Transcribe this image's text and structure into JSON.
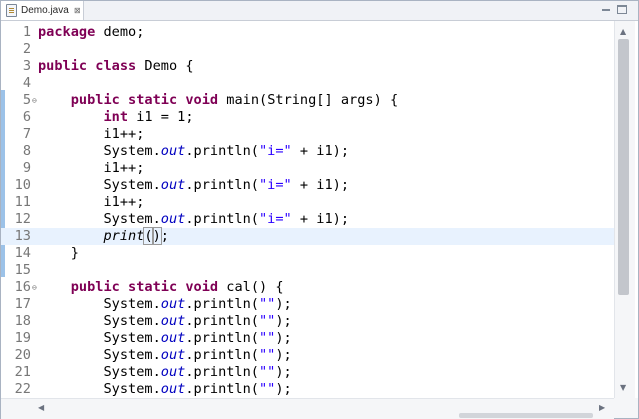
{
  "tab": {
    "label": "Demo.java",
    "close_glyph": "⊠",
    "icon": "java-file-icon"
  },
  "window_controls": {
    "minimize_icon": "minimize-icon",
    "maximize_icon": "maximize-icon"
  },
  "editor": {
    "lines": [
      {
        "num": "1",
        "tokens": [
          {
            "t": "kw",
            "v": "package"
          },
          {
            "t": "txt",
            "v": " demo;"
          }
        ]
      },
      {
        "num": "2",
        "tokens": []
      },
      {
        "num": "3",
        "tokens": [
          {
            "t": "kw",
            "v": "public"
          },
          {
            "t": "txt",
            "v": " "
          },
          {
            "t": "kw",
            "v": "class"
          },
          {
            "t": "txt",
            "v": " Demo {"
          }
        ]
      },
      {
        "num": "4",
        "tokens": []
      },
      {
        "num": "5",
        "fold": "⊖",
        "tokens": [
          {
            "t": "txt",
            "v": "    "
          },
          {
            "t": "kw",
            "v": "public"
          },
          {
            "t": "txt",
            "v": " "
          },
          {
            "t": "kw",
            "v": "static"
          },
          {
            "t": "txt",
            "v": " "
          },
          {
            "t": "kw",
            "v": "void"
          },
          {
            "t": "txt",
            "v": " main(String[] args) {"
          }
        ]
      },
      {
        "num": "6",
        "tokens": [
          {
            "t": "txt",
            "v": "        "
          },
          {
            "t": "kw",
            "v": "int"
          },
          {
            "t": "txt",
            "v": " i1 = 1;"
          }
        ]
      },
      {
        "num": "7",
        "tokens": [
          {
            "t": "txt",
            "v": "        i1++;"
          }
        ]
      },
      {
        "num": "8",
        "tokens": [
          {
            "t": "txt",
            "v": "        System."
          },
          {
            "t": "field",
            "v": "out"
          },
          {
            "t": "txt",
            "v": ".println("
          },
          {
            "t": "str",
            "v": "\"i=\""
          },
          {
            "t": "txt",
            "v": " + i1);"
          }
        ]
      },
      {
        "num": "9",
        "tokens": [
          {
            "t": "txt",
            "v": "        i1++;"
          }
        ]
      },
      {
        "num": "10",
        "tokens": [
          {
            "t": "txt",
            "v": "        System."
          },
          {
            "t": "field",
            "v": "out"
          },
          {
            "t": "txt",
            "v": ".println("
          },
          {
            "t": "str",
            "v": "\"i=\""
          },
          {
            "t": "txt",
            "v": " + i1);"
          }
        ]
      },
      {
        "num": "11",
        "tokens": [
          {
            "t": "txt",
            "v": "        i1++;"
          }
        ]
      },
      {
        "num": "12",
        "tokens": [
          {
            "t": "txt",
            "v": "        System."
          },
          {
            "t": "field",
            "v": "out"
          },
          {
            "t": "txt",
            "v": ".println("
          },
          {
            "t": "str",
            "v": "\"i=\""
          },
          {
            "t": "txt",
            "v": " + i1);"
          }
        ]
      },
      {
        "num": "13",
        "current": true,
        "tokens": [
          {
            "t": "txt",
            "v": "        "
          },
          {
            "t": "it",
            "v": "print"
          },
          {
            "t": "box",
            "v": "("
          },
          {
            "t": "box",
            "v": ")"
          },
          {
            "t": "txt",
            "v": ";"
          }
        ]
      },
      {
        "num": "14",
        "tokens": [
          {
            "t": "txt",
            "v": "    }"
          }
        ]
      },
      {
        "num": "15",
        "tokens": []
      },
      {
        "num": "16",
        "fold": "⊖",
        "tokens": [
          {
            "t": "txt",
            "v": "    "
          },
          {
            "t": "kw",
            "v": "public"
          },
          {
            "t": "txt",
            "v": " "
          },
          {
            "t": "kw",
            "v": "static"
          },
          {
            "t": "txt",
            "v": " "
          },
          {
            "t": "kw",
            "v": "void"
          },
          {
            "t": "txt",
            "v": " cal() {"
          }
        ]
      },
      {
        "num": "17",
        "tokens": [
          {
            "t": "txt",
            "v": "        System."
          },
          {
            "t": "field",
            "v": "out"
          },
          {
            "t": "txt",
            "v": ".println("
          },
          {
            "t": "str",
            "v": "\"\""
          },
          {
            "t": "txt",
            "v": ");"
          }
        ]
      },
      {
        "num": "18",
        "tokens": [
          {
            "t": "txt",
            "v": "        System."
          },
          {
            "t": "field",
            "v": "out"
          },
          {
            "t": "txt",
            "v": ".println("
          },
          {
            "t": "str",
            "v": "\"\""
          },
          {
            "t": "txt",
            "v": ");"
          }
        ]
      },
      {
        "num": "19",
        "tokens": [
          {
            "t": "txt",
            "v": "        System."
          },
          {
            "t": "field",
            "v": "out"
          },
          {
            "t": "txt",
            "v": ".println("
          },
          {
            "t": "str",
            "v": "\"\""
          },
          {
            "t": "txt",
            "v": ");"
          }
        ]
      },
      {
        "num": "20",
        "tokens": [
          {
            "t": "txt",
            "v": "        System."
          },
          {
            "t": "field",
            "v": "out"
          },
          {
            "t": "txt",
            "v": ".println("
          },
          {
            "t": "str",
            "v": "\"\""
          },
          {
            "t": "txt",
            "v": ");"
          }
        ]
      },
      {
        "num": "21",
        "tokens": [
          {
            "t": "txt",
            "v": "        System."
          },
          {
            "t": "field",
            "v": "out"
          },
          {
            "t": "txt",
            "v": ".println("
          },
          {
            "t": "str",
            "v": "\"\""
          },
          {
            "t": "txt",
            "v": ");"
          }
        ]
      },
      {
        "num": "22",
        "tokens": [
          {
            "t": "txt",
            "v": "        System."
          },
          {
            "t": "field",
            "v": "out"
          },
          {
            "t": "txt",
            "v": ".println("
          },
          {
            "t": "str",
            "v": "\"\""
          },
          {
            "t": "txt",
            "v": ");"
          }
        ]
      }
    ]
  },
  "scrollbars": {
    "up_glyph": "▲",
    "down_glyph": "▼",
    "left_glyph": "◀",
    "right_glyph": "▶"
  },
  "colors": {
    "keyword": "#7f0055",
    "string": "#2a00ff",
    "field": "#0000c0",
    "current_line": "#e8f2fe",
    "change_marker": "#9cc2e8"
  }
}
